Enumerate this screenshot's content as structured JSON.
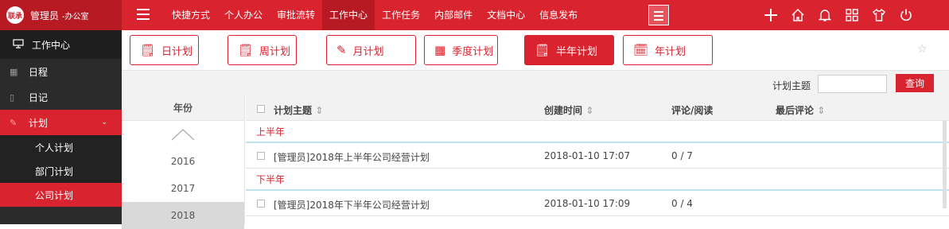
{
  "brand": {
    "logo": "联承",
    "user": "管理员",
    "dept": "-办公室"
  },
  "nav": [
    "快捷方式",
    "个人办公",
    "审批流转",
    "工作中心",
    "工作任务",
    "内部邮件",
    "文档中心",
    "信息发布"
  ],
  "nav_active": "工作中心",
  "right_icons": [
    "plus-icon",
    "home-icon",
    "bell-icon",
    "apps-icon",
    "shirt-icon",
    "power-icon"
  ],
  "sidebar": {
    "header": "工作中心",
    "items": [
      {
        "label": "日程"
      },
      {
        "label": "日记"
      },
      {
        "label": "计划"
      }
    ],
    "sub": [
      "个人计划",
      "部门计划",
      "公司计划"
    ],
    "sub_active": "公司计划"
  },
  "tabs": [
    {
      "label": "日计划"
    },
    {
      "label": "周计划"
    },
    {
      "label": "月计划"
    },
    {
      "label": "季度计划"
    },
    {
      "label": "半年计划"
    },
    {
      "label": "年计划"
    }
  ],
  "tab_active": "半年计划",
  "filter": {
    "label": "计划主题",
    "value": "",
    "button": "查询"
  },
  "years": {
    "header": "年份",
    "list": [
      "2016",
      "2017",
      "2018"
    ],
    "selected": "2018"
  },
  "table": {
    "columns": [
      "计划主题",
      "创建时间",
      "评论/阅读",
      "最后评论"
    ],
    "groups": [
      {
        "name": "上半年",
        "rows": [
          {
            "title": "[管理员]2018年上半年公司经营计划",
            "created": "2018-01-10 17:07",
            "stats": "0 / 7",
            "last": ""
          }
        ]
      },
      {
        "name": "下半年",
        "rows": [
          {
            "title": "[管理员]2018年下半年公司经营计划",
            "created": "2018-01-10 17:09",
            "stats": "0 / 4",
            "last": ""
          }
        ]
      }
    ]
  },
  "colors": {
    "primary": "#d9232f",
    "dark_red": "#b81a24",
    "sidebar_bg": "#2b2b2b"
  }
}
